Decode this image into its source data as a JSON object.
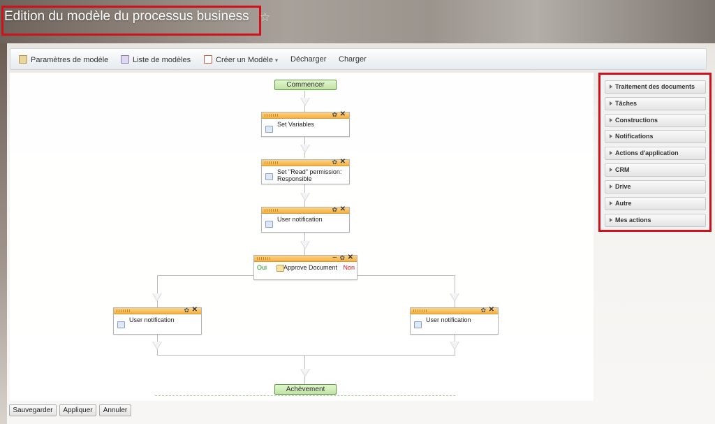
{
  "page": {
    "title": "Edition du modèle du processus business",
    "star_glyph": "☆"
  },
  "toolbar": {
    "items": [
      {
        "label": "Paramètres de modèle",
        "icon": "settings-doc-icon"
      },
      {
        "label": "Liste de modèles",
        "icon": "list-icon"
      },
      {
        "label": "Créer un Modèle",
        "icon": "new-doc-icon",
        "dropdown": true
      },
      {
        "label": "Décharger"
      },
      {
        "label": "Charger"
      }
    ],
    "dropdown_glyph": "▾"
  },
  "flow": {
    "start": "Commencer",
    "end": "Achèvement",
    "blocks": [
      {
        "label": "Set Variables",
        "icon": "variables-icon"
      },
      {
        "label": "Set \"Read\" permission: Responsible",
        "icon": "permission-icon"
      },
      {
        "label": "User notification",
        "icon": "notification-icon"
      },
      {
        "label": "Approve Document",
        "icon": "approve-icon",
        "yes": "Oui",
        "no": "Non"
      },
      {
        "label": "User notification",
        "icon": "notification-icon"
      },
      {
        "label": "User notification",
        "icon": "notification-icon"
      }
    ],
    "gear_glyph": "✿",
    "close_glyph": "✕",
    "minus_glyph": "–"
  },
  "panel": {
    "items": [
      "Traitement des documents",
      "Tâches",
      "Constructions",
      "Notifications",
      "Actions d'application",
      "CRM",
      "Drive",
      "Autre",
      "Mes actions"
    ]
  },
  "buttons": {
    "save": "Sauvegarder",
    "apply": "Appliquer",
    "cancel": "Annuler"
  },
  "colors": {
    "highlight": "#d0111b",
    "block_header": "#f5b041",
    "start_end": "#bfe3a4",
    "yes": "#1a8f1a",
    "no": "#c81a1a"
  }
}
